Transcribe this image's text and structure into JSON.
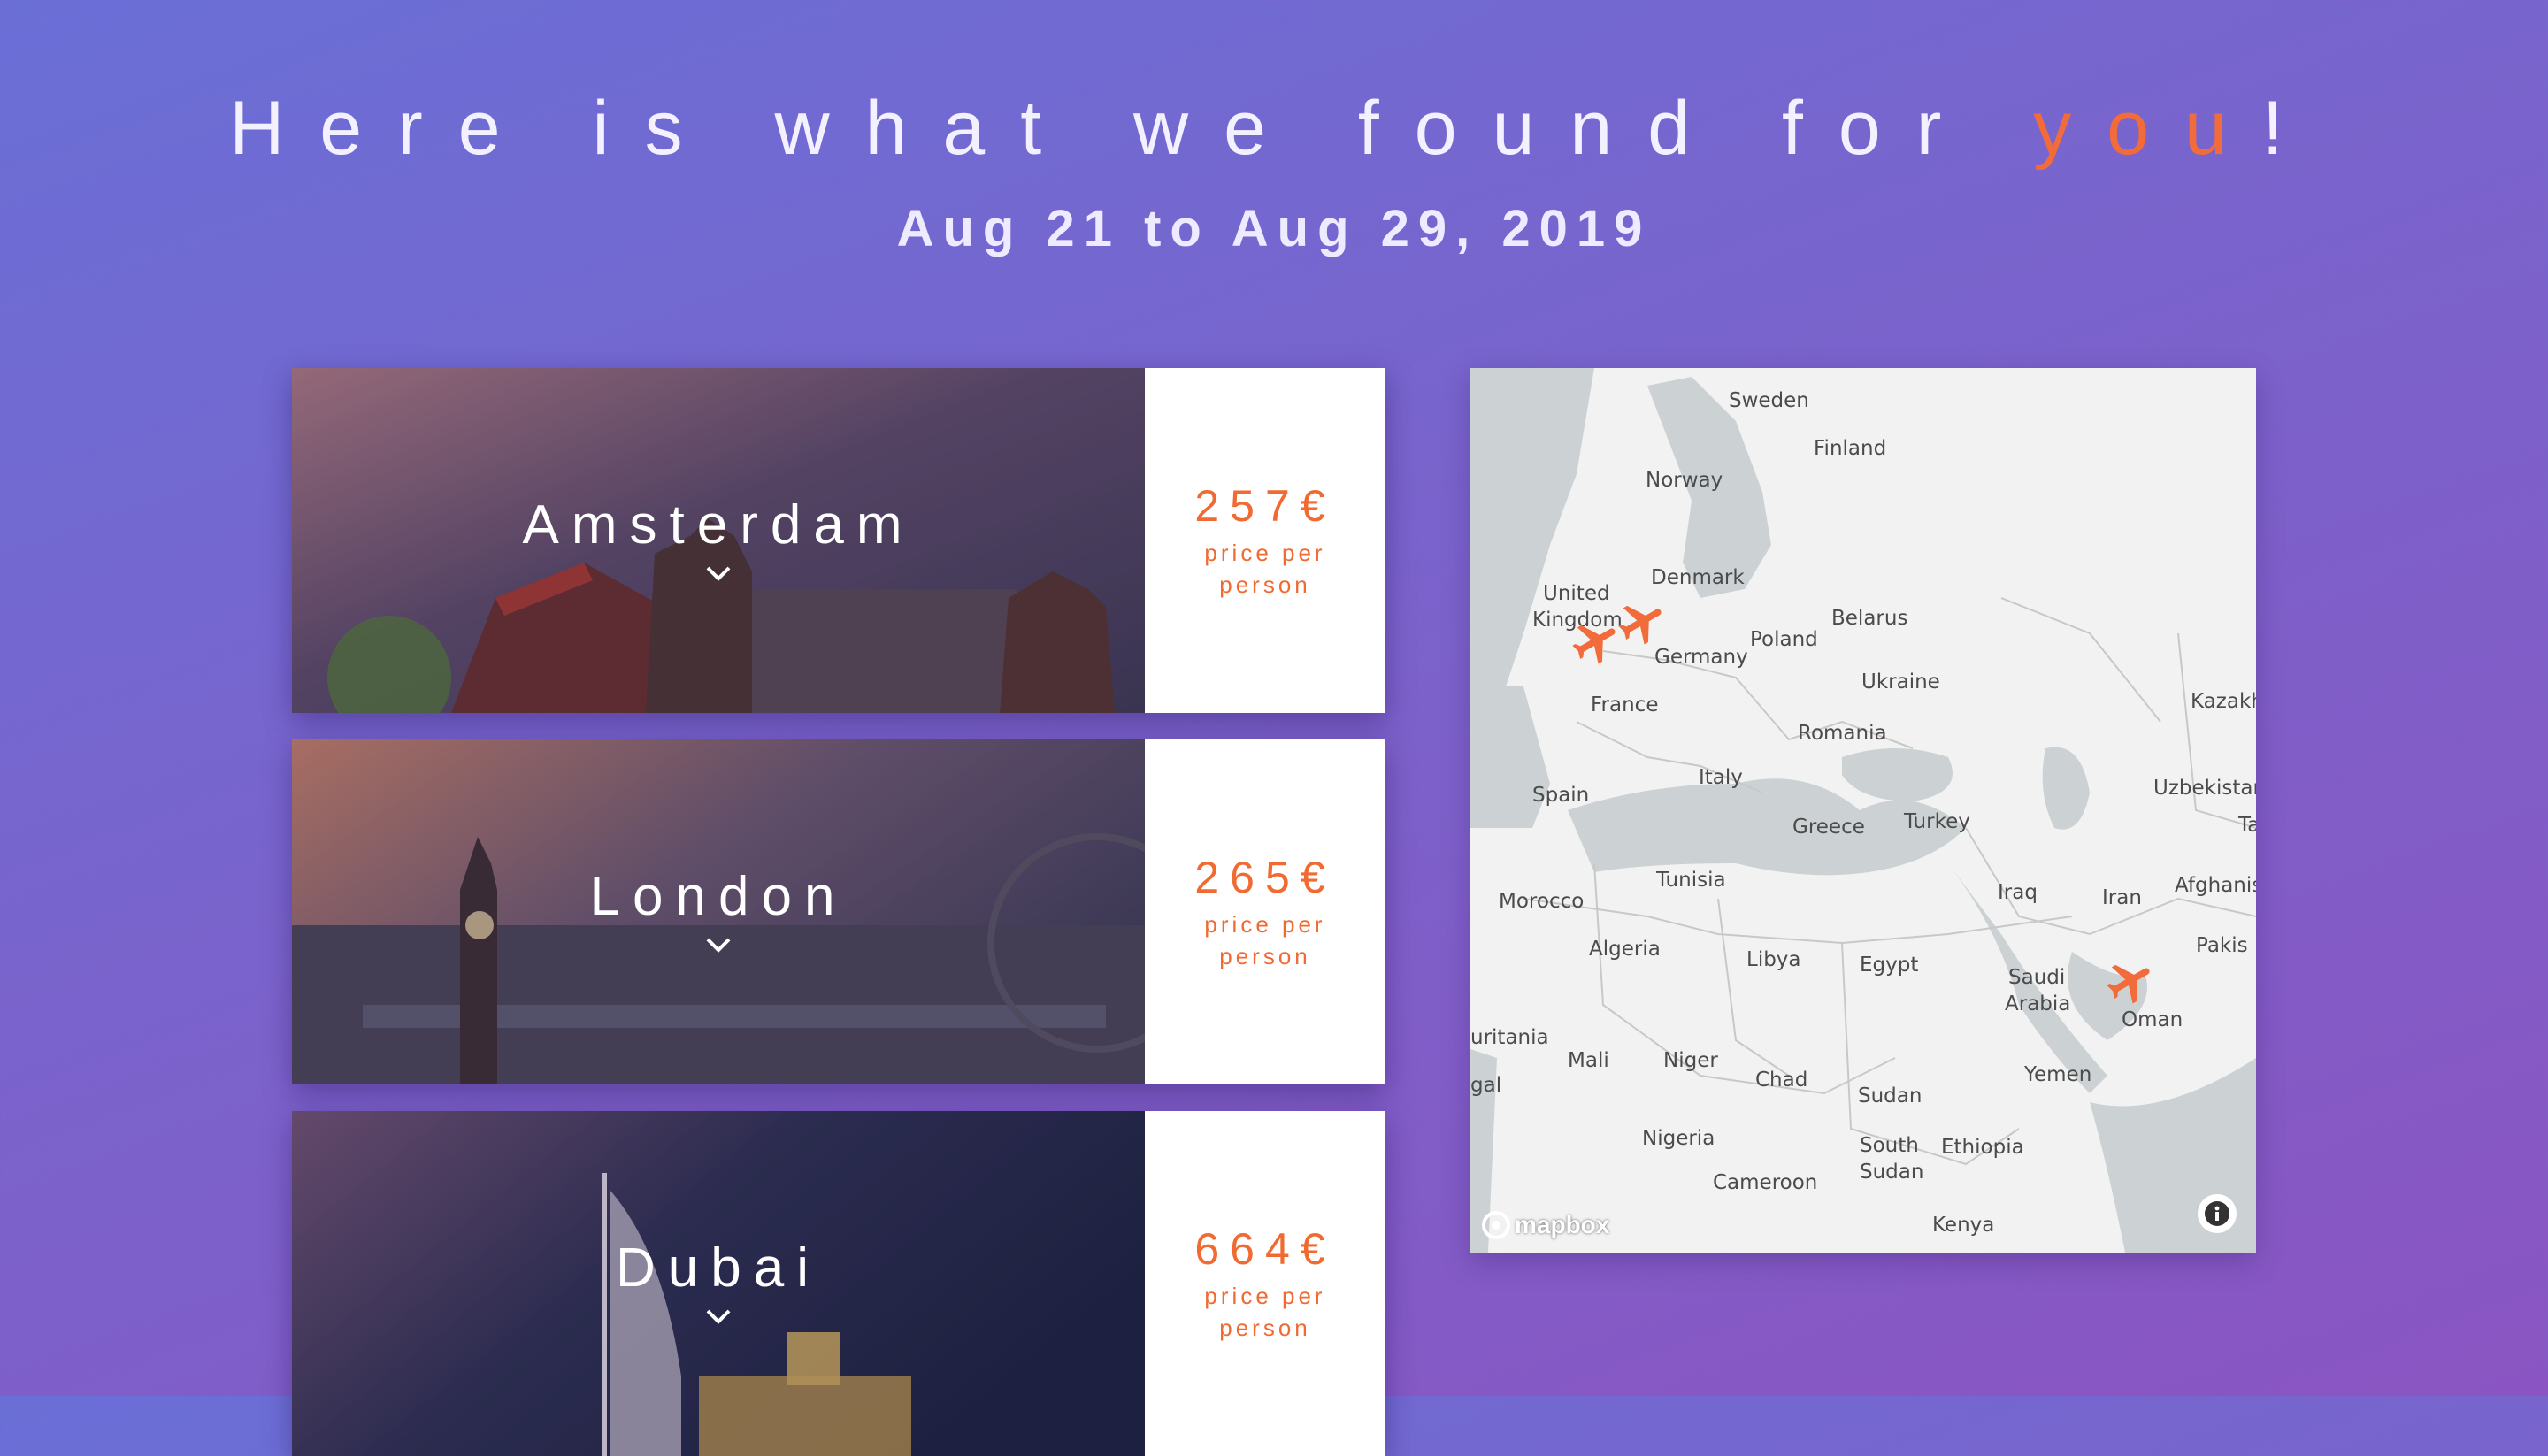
{
  "header": {
    "headline_main": "Here is what we found for ",
    "headline_accent": "you",
    "headline_end": "!",
    "dates": "Aug 21 to Aug 29, 2019"
  },
  "results": [
    {
      "city": "Amsterdam",
      "price": "257€",
      "price_label": "price per person"
    },
    {
      "city": "London",
      "price": "265€",
      "price_label": "price per person"
    },
    {
      "city": "Dubai",
      "price": "664€",
      "price_label": "price per person"
    }
  ],
  "map": {
    "labels": [
      "Sweden",
      "Finland",
      "Norway",
      "Denmark",
      "United",
      "Kingdom",
      "Belarus",
      "Poland",
      "Germany",
      "France",
      "Ukraine",
      "Romania",
      "Kazakh",
      "Spain",
      "Italy",
      "Greece",
      "Turkey",
      "Uzbekistan",
      "Tunisia",
      "Morocco",
      "Iraq",
      "Iran",
      "Afghanis",
      "Algeria",
      "Libya",
      "Egypt",
      "Saudi",
      "Arabia",
      "Oman",
      "Pakis",
      "Mali",
      "Niger",
      "Chad",
      "Sudan",
      "Yemen",
      "Nigeria",
      "South",
      "Sudan",
      "Ethiopia",
      "Cameroon",
      "Kenya",
      "uritania",
      "gal",
      "Ta"
    ],
    "attribution": "mapbox"
  },
  "colors": {
    "accent": "#f26b3a",
    "background_start": "#6a6fd6",
    "background_end": "#8a55c2"
  }
}
